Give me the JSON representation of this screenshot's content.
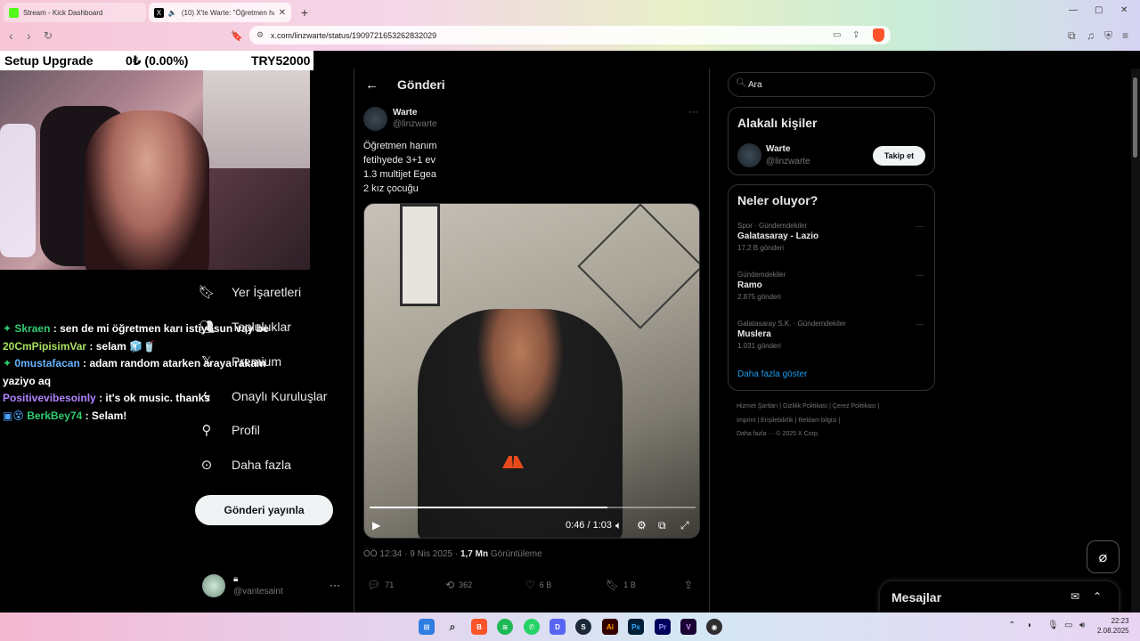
{
  "browser": {
    "tabs": [
      {
        "title": "Stream - Kick Dashboard"
      },
      {
        "title": "(10) X'te Warte: \"Öğretmen ha"
      }
    ],
    "url": "x.com/linzwarte/status/1909721653262832029"
  },
  "overlay": {
    "label": "Setup Upgrade",
    "progress": "0₺ (0.00%)",
    "goal": "TRY52000"
  },
  "chat": [
    {
      "user": "Skraen",
      "message": ": sen de mi öğretmen karı istiyosun vay be",
      "badge": "gem",
      "color": "#2ecc71"
    },
    {
      "user": "20CmPipisimVar",
      "message": ": selam 🧊🥤",
      "badge": "",
      "color": "#a8e063"
    },
    {
      "user": "0mustafacan",
      "message": ": adam random atarken araya rakam",
      "badge": "gem",
      "color": "#66b3ff"
    },
    {
      "user": "",
      "message": "yaziyo aq",
      "badge": "",
      "color": "#ffffff"
    },
    {
      "user": "Positivevibesoinly",
      "message": ": it's ok music. thanks",
      "badge": "",
      "color": "#b084ff"
    },
    {
      "user": "BerkBey74",
      "message": ": Selam!",
      "badge": "emotes",
      "color": "#2ecc71"
    }
  ],
  "nav": {
    "items": [
      {
        "label": "Yer İşaretleri",
        "icon": "bookmark-icon"
      },
      {
        "label": "Topluluklar",
        "icon": "communities-icon"
      },
      {
        "label": "Premium",
        "icon": "x-logo-icon"
      },
      {
        "label": "Onaylı Kuruluşlar",
        "icon": "lightning-icon"
      },
      {
        "label": "Profil",
        "icon": "person-icon"
      },
      {
        "label": "Daha fazla",
        "icon": "more-circle-icon"
      }
    ],
    "post_button": "Gönderi yayınla",
    "account_handle": "@vantesaint"
  },
  "post": {
    "header": "Gönderi",
    "author_name": "Warte",
    "author_handle": "@linzwarte",
    "text_lines": [
      "Öğretmen hanım",
      "fetihyede 3+1 ev",
      "1.3 multijet Egea",
      "2 kız çocuğu"
    ],
    "video": {
      "time": "0:46 / 1:03",
      "progress_fraction": 0.73
    },
    "timestamp": "ÖÖ 12:34 · 9 Nis 2025 · ",
    "views": "1,7 Mn",
    "views_label": " Görüntüleme",
    "replies": "71",
    "reposts": "362",
    "likes": "6 B",
    "bookmarks": "1 B"
  },
  "sidebar": {
    "search_placeholder": "Ara",
    "relevant_title": "Alakalı kişiler",
    "relevant_name": "Warte",
    "relevant_handle": "@linzwarte",
    "follow_label": "Takip et",
    "trends_title": "Neler oluyor?",
    "trends": [
      {
        "category": "Spor · Gündemdekiler",
        "name": "Galatasaray - Lazio",
        "count": "17,2 B gönderi"
      },
      {
        "category": "Gündemdekiler",
        "name": "Ramo",
        "count": "2.875 gönderi"
      },
      {
        "category": "Galatasaray S.K. · Gündemdekiler",
        "name": "Muslera",
        "count": "1.031 gönderi"
      }
    ],
    "show_more": "Daha fazla göster",
    "footer_line1": "Hizmet Şartları  |  Gizlilik Politikası  |  Çerez Politikası  |",
    "footer_line2": "Imprint  |  Erişilebilirlik  |  Reklam bilgisi  |",
    "footer_line3": "Daha fazla ···   © 2025 X Corp."
  },
  "messages": {
    "title": "Mesajlar"
  },
  "taskbar": {
    "time": "22:23",
    "date": "2.08.2025"
  }
}
